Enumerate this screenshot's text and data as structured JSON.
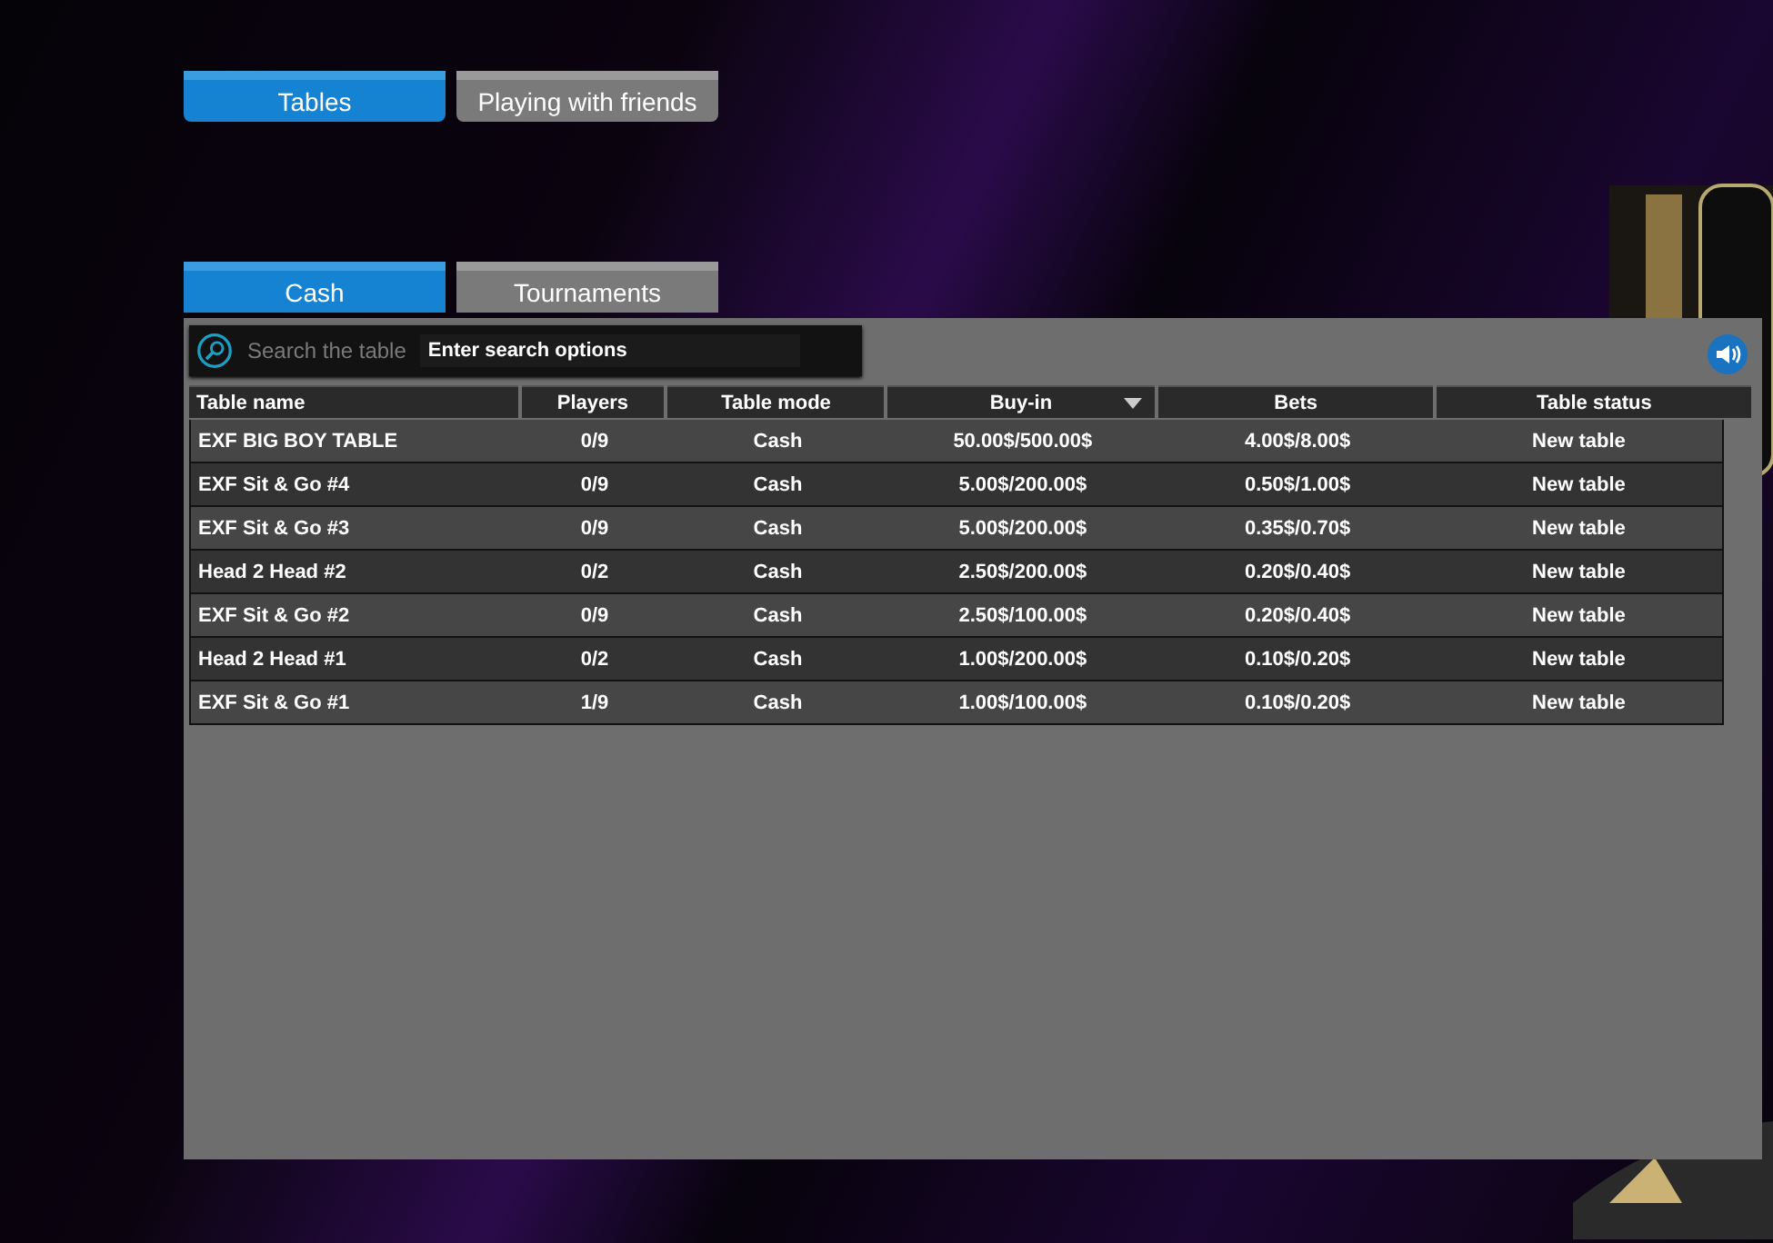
{
  "main_tabs": [
    {
      "label": "Tables",
      "selected": true
    },
    {
      "label": "Playing with friends",
      "selected": false
    }
  ],
  "sub_tabs": [
    {
      "label": "Cash",
      "selected": true
    },
    {
      "label": "Tournaments",
      "selected": false
    }
  ],
  "search": {
    "label": "Search the table",
    "placeholder": "Enter search options"
  },
  "table": {
    "columns": [
      {
        "label": "Table name",
        "sorted": false
      },
      {
        "label": "Players",
        "sorted": false
      },
      {
        "label": "Table mode",
        "sorted": false
      },
      {
        "label": "Buy-in",
        "sorted": true
      },
      {
        "label": "Bets",
        "sorted": false
      },
      {
        "label": "Table status",
        "sorted": false
      }
    ],
    "rows": [
      [
        "EXF BIG BOY TABLE",
        "0/9",
        "Cash",
        "50.00$/500.00$",
        "4.00$/8.00$",
        "New table"
      ],
      [
        "EXF Sit & Go #4",
        "0/9",
        "Cash",
        "5.00$/200.00$",
        "0.50$/1.00$",
        "New table"
      ],
      [
        "EXF Sit & Go #3",
        "0/9",
        "Cash",
        "5.00$/200.00$",
        "0.35$/0.70$",
        "New table"
      ],
      [
        "Head 2 Head #2",
        "0/2",
        "Cash",
        "2.50$/200.00$",
        "0.20$/0.40$",
        "New table"
      ],
      [
        "EXF Sit & Go #2",
        "0/9",
        "Cash",
        "2.50$/100.00$",
        "0.20$/0.40$",
        "New table"
      ],
      [
        "Head 2 Head #1",
        "0/2",
        "Cash",
        "1.00$/200.00$",
        "0.10$/0.20$",
        "New table"
      ],
      [
        "EXF Sit & Go #1",
        "1/9",
        "Cash",
        "1.00$/100.00$",
        "0.10$/0.20$",
        "New table"
      ]
    ]
  }
}
